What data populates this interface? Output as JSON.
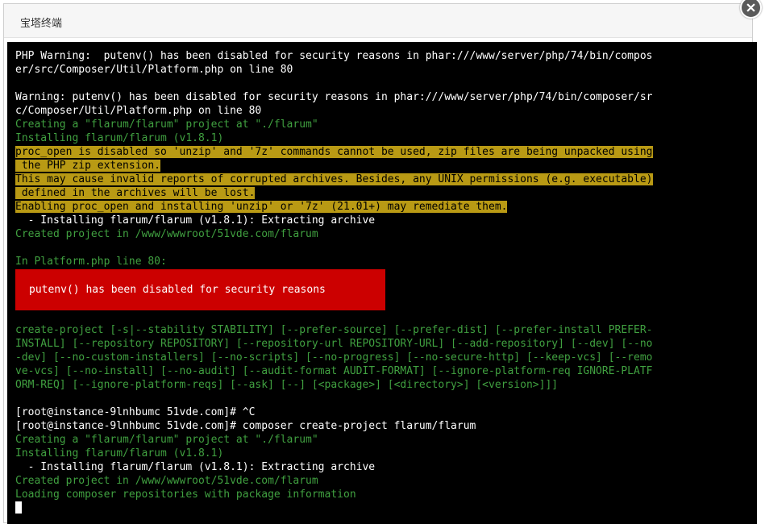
{
  "dialog": {
    "title": "宝塔终端",
    "close_icon": "close-icon"
  },
  "terminal": {
    "lines": [
      {
        "t": "PHP Warning:  putenv() has been disabled for security reasons in phar:///www/server/php/74/bin/compos",
        "c": ""
      },
      {
        "t": "er/src/Composer/Util/Platform.php on line 80",
        "c": ""
      },
      {
        "t": "",
        "c": ""
      },
      {
        "t": "Warning: putenv() has been disabled for security reasons in phar:///www/server/php/74/bin/composer/sr",
        "c": ""
      },
      {
        "t": "c/Composer/Util/Platform.php on line 80",
        "c": ""
      },
      {
        "t": "Creating a \"flarum/flarum\" project at \"./flarum\"",
        "c": "g"
      },
      {
        "t": "Installing flarum/flarum (v1.8.1)",
        "c": "g"
      },
      {
        "t": "proc_open is disabled so 'unzip' and '7z' commands cannot be used, zip files are being unpacked using",
        "c": "y"
      },
      {
        "t": " the PHP zip extension.",
        "c": "y"
      },
      {
        "t": "This may cause invalid reports of corrupted archives. Besides, any UNIX permissions (e.g. executable)",
        "c": "y"
      },
      {
        "t": " defined in the archives will be lost.",
        "c": "y"
      },
      {
        "t": "Enabling proc_open and installing 'unzip' or '7z' (21.01+) may remediate them.",
        "c": "y"
      },
      {
        "t": "  - Installing flarum/flarum (v1.8.1): Extracting archive",
        "c": ""
      },
      {
        "t": "Created project in /www/wwwroot/51vde.com/flarum",
        "c": "g"
      },
      {
        "t": "",
        "c": ""
      },
      {
        "t": "In Platform.php line 80:",
        "c": "g"
      },
      {
        "t": "",
        "c": ""
      },
      {
        "t": "",
        "c": ""
      },
      {
        "t": "",
        "c": ""
      },
      {
        "t": "",
        "c": ""
      },
      {
        "t": "create-project [-s|--stability STABILITY] [--prefer-source] [--prefer-dist] [--prefer-install PREFER-",
        "c": "g"
      },
      {
        "t": "INSTALL] [--repository REPOSITORY] [--repository-url REPOSITORY-URL] [--add-repository] [--dev] [--no",
        "c": "g"
      },
      {
        "t": "-dev] [--no-custom-installers] [--no-scripts] [--no-progress] [--no-secure-http] [--keep-vcs] [--remo",
        "c": "g"
      },
      {
        "t": "ve-vcs] [--no-install] [--no-audit] [--audit-format AUDIT-FORMAT] [--ignore-platform-req IGNORE-PLATF",
        "c": "g"
      },
      {
        "t": "ORM-REQ] [--ignore-platform-reqs] [--ask] [--] [<package>] [<directory>] [<version>]]]",
        "c": "g"
      },
      {
        "t": "",
        "c": ""
      },
      {
        "t": "[root@instance-9lnhbumc 51vde.com]# ^C",
        "c": ""
      },
      {
        "t": "[root@instance-9lnhbumc 51vde.com]# composer create-project flarum/flarum",
        "c": ""
      },
      {
        "t": "Creating a \"flarum/flarum\" project at \"./flarum\"",
        "c": "g"
      },
      {
        "t": "Installing flarum/flarum (v1.8.1)",
        "c": "g"
      },
      {
        "t": "  - Installing flarum/flarum (v1.8.1): Extracting archive",
        "c": ""
      },
      {
        "t": "Created project in /www/wwwroot/51vde.com/flarum",
        "c": "g"
      },
      {
        "t": "Loading composer repositories with package information",
        "c": "g"
      }
    ],
    "error_box": "putenv() has been disabled for security reasons",
    "colors": {
      "green": "#40a040",
      "warning_bg": "#b99a14",
      "error_bg": "#cc0000"
    }
  }
}
